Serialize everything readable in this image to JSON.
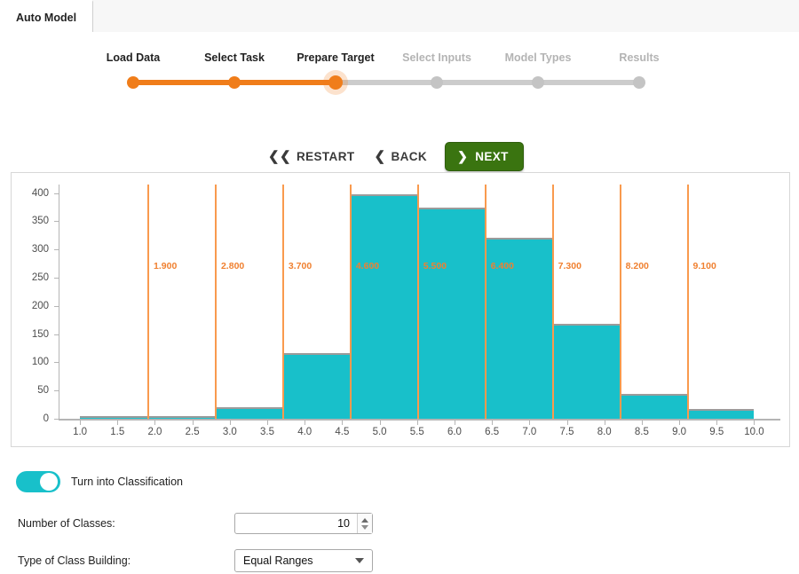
{
  "tab": {
    "label": "Auto Model"
  },
  "wizard": {
    "steps": [
      {
        "label": "Load Data",
        "state": "done"
      },
      {
        "label": "Select Task",
        "state": "done"
      },
      {
        "label": "Prepare Target",
        "state": "current"
      },
      {
        "label": "Select Inputs",
        "state": "todo"
      },
      {
        "label": "Model Types",
        "state": "todo"
      },
      {
        "label": "Results",
        "state": "todo"
      }
    ],
    "nav": {
      "restart_label": "RESTART",
      "restart_icon": "double-chevron-left-icon",
      "back_label": "BACK",
      "back_icon": "chevron-left-icon",
      "next_label": "NEXT",
      "next_icon": "chevron-right-icon"
    },
    "colors": {
      "accent": "#f07d1a",
      "inactive": "#c4c4c4",
      "next_button": "#3a7410"
    }
  },
  "chart_data": {
    "type": "bar",
    "title": "",
    "xlabel": "",
    "ylabel": "",
    "xlim": [
      0.75,
      10.35
    ],
    "ylim": [
      0,
      415
    ],
    "grid": false,
    "legend": false,
    "bar_color": "#18c0ca",
    "break_color": "#f99a4e",
    "ytick_labels": [
      "0",
      "50",
      "100",
      "150",
      "200",
      "250",
      "300",
      "350",
      "400"
    ],
    "yticks": [
      0,
      50,
      100,
      150,
      200,
      250,
      300,
      350,
      400
    ],
    "xtick_labels": [
      "1.0",
      "1.5",
      "2.0",
      "2.5",
      "3.0",
      "3.5",
      "4.0",
      "4.5",
      "5.0",
      "5.5",
      "6.0",
      "6.5",
      "7.0",
      "7.5",
      "8.0",
      "8.5",
      "9.0",
      "9.5",
      "10.0"
    ],
    "xticks": [
      1.0,
      1.5,
      2.0,
      2.5,
      3.0,
      3.5,
      4.0,
      4.5,
      5.0,
      5.5,
      6.0,
      6.5,
      7.0,
      7.5,
      8.0,
      8.5,
      9.0,
      9.5,
      10.0
    ],
    "bins": [
      {
        "x0": 1.0,
        "x1": 2.8,
        "value": 2
      },
      {
        "x0": 2.8,
        "x1": 3.7,
        "value": 20
      },
      {
        "x0": 3.7,
        "x1": 4.6,
        "value": 117
      },
      {
        "x0": 4.6,
        "x1": 5.5,
        "value": 398
      },
      {
        "x0": 5.5,
        "x1": 6.4,
        "value": 374
      },
      {
        "x0": 6.4,
        "x1": 7.3,
        "value": 320
      },
      {
        "x0": 7.3,
        "x1": 8.2,
        "value": 169
      },
      {
        "x0": 8.2,
        "x1": 9.1,
        "value": 44
      },
      {
        "x0": 9.1,
        "x1": 10.0,
        "value": 18
      }
    ],
    "break_lines": [
      {
        "x": 1.9,
        "label": "1.900"
      },
      {
        "x": 2.8,
        "label": "2.800"
      },
      {
        "x": 3.7,
        "label": "3.700"
      },
      {
        "x": 4.6,
        "label": "4.600"
      },
      {
        "x": 5.5,
        "label": "5.500"
      },
      {
        "x": 6.4,
        "label": "6.400"
      },
      {
        "x": 7.3,
        "label": "7.300"
      },
      {
        "x": 8.2,
        "label": "8.200"
      },
      {
        "x": 9.1,
        "label": "9.100"
      }
    ]
  },
  "controls": {
    "classification_toggle": {
      "label": "Turn into Classification",
      "on": true
    },
    "number_of_classes": {
      "label": "Number of Classes:",
      "value": "10"
    },
    "type_of_class_building": {
      "label": "Type of Class Building:",
      "value": "Equal Ranges"
    }
  }
}
